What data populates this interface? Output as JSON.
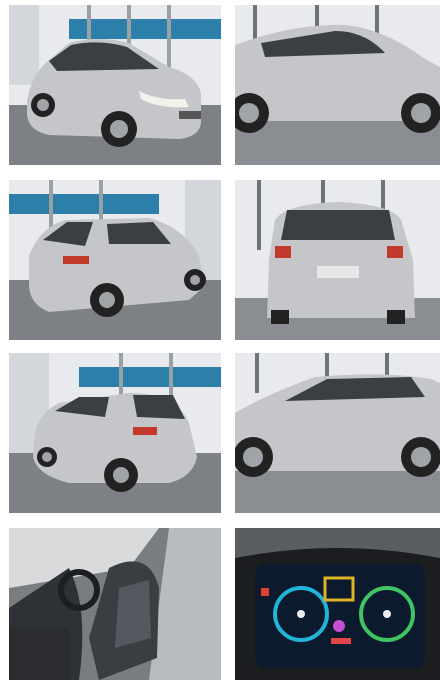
{
  "gallery": {
    "photos": [
      {
        "view": "front-three-quarter"
      },
      {
        "view": "side-right"
      },
      {
        "view": "rear-three-quarter-left"
      },
      {
        "view": "rear"
      },
      {
        "view": "rear-three-quarter-left-alt"
      },
      {
        "view": "side-right-alt"
      },
      {
        "view": "interior-front-seats"
      },
      {
        "view": "instrument-cluster"
      }
    ],
    "colors": {
      "car_body": "#c4c6c9",
      "showroom_wall": "#e9ebee",
      "accent_stripe": "#2b7fa8",
      "floor": "#7d8084"
    }
  }
}
